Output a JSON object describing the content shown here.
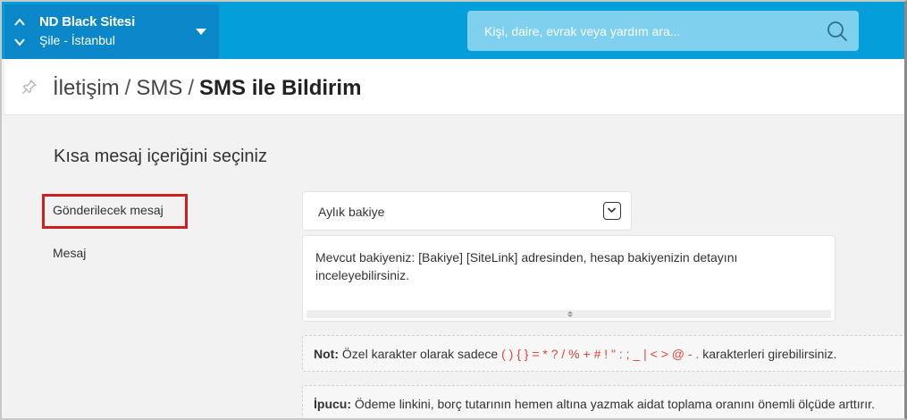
{
  "site": {
    "name": "ND Black Sitesi",
    "city": "Şile - İstanbul",
    "icons": [
      "chevron-up-icon",
      "chevron-down-icon",
      "caret-down-icon"
    ]
  },
  "search": {
    "placeholder": "Kişi, daire, evrak veya yardım ara...",
    "value": "",
    "icon": "search-icon"
  },
  "breadcrumb": {
    "items": [
      "İletişim",
      "SMS"
    ],
    "separator": "/",
    "current": "SMS ile Bildirim",
    "icon": "pin-icon"
  },
  "form": {
    "title": "Kısa mesaj içeriğini seçiniz",
    "message_select_label": "Gönderilecek mesaj",
    "message_select_value": "Aylık bakiye",
    "message_label": "Mesaj",
    "message_text": "Mevcut bakiyeniz: [Bakiye] [SiteLink] adresinden, hesap bakiyenizin detayını inceleyebilirsiniz.",
    "note_prefix": "Not:",
    "note_text": "Özel karakter olarak sadece",
    "note_specials": "( ) { } = * ? / % + # ! \" : ; _ | < > @ - .",
    "note_suffix": "karakterleri girebilirsiniz.",
    "tip_prefix": "İpucu:",
    "tip_text": "Ödeme linkini, borç tutarının hemen altına yazmak aidat toplama oranını önemli ölçüde arttırır."
  },
  "colors": {
    "topbar": "#049fdb",
    "site_box": "#0a87c8",
    "highlight": "#cc1f1f",
    "special_chars": "#e0453a"
  }
}
